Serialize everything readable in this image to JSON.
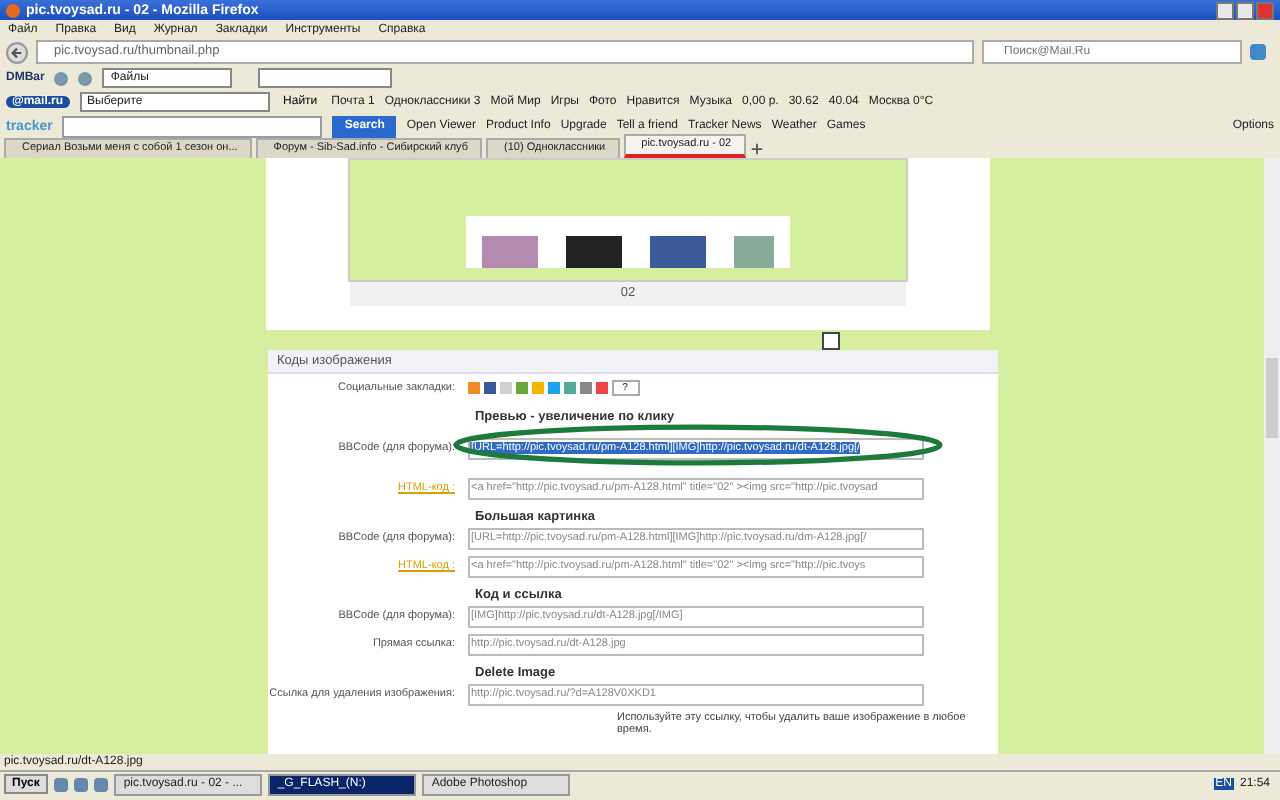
{
  "window": {
    "title": "pic.tvoysad.ru - 02 - Mozilla Firefox"
  },
  "menu": [
    "Файл",
    "Правка",
    "Вид",
    "Журнал",
    "Закладки",
    "Инструменты",
    "Справка"
  ],
  "navigation": {
    "url": "pic.tvoysad.ru/thumbnail.php",
    "search_placeholder": "Поиск@Mail.Ru"
  },
  "dmbar": {
    "logo": "DMBar",
    "dropdown": "Файлы"
  },
  "mail_toolbar": {
    "logo": "@mail.ru",
    "dropdown": "Выберите",
    "find": "Найти",
    "items": [
      "Почта 1",
      "Одноклассники 3",
      "Мой Мир",
      "Игры",
      "Фото",
      "Нравится",
      "Музыка",
      "0,00 р.",
      "30.62",
      "40.04",
      "Москва 0°C"
    ]
  },
  "tracker_toolbar": {
    "logo": "tracker",
    "search_button": "Search",
    "items": [
      "Open Viewer",
      "Product Info",
      "Upgrade",
      "Tell a friend",
      "Tracker News",
      "Weather",
      "Games"
    ],
    "options": "Options"
  },
  "tabs": [
    {
      "label": "Сериал Возьми меня с собой 1 сезон он...",
      "selected": false
    },
    {
      "label": "Форум - Sib-Sad.info - Сибирский клуб",
      "selected": false
    },
    {
      "label": "(10) Одноклассники",
      "selected": false
    },
    {
      "label": "pic.tvoysad.ru - 02",
      "selected": true
    }
  ],
  "preview": {
    "caption": "02"
  },
  "codes": {
    "title": "Коды изображения",
    "social_label": "Социальные закладки:",
    "help": "?",
    "sections": [
      {
        "heading": "Превью - увеличение по клику",
        "rows": [
          {
            "label": "BBCode (для форума):",
            "link": false,
            "value": "[URL=http://pic.tvoysad.ru/pm-A128.html][IMG]http://pic.tvoysad.ru/dt-A128.jpg[/",
            "selected": true
          },
          {
            "label": "HTML-код :",
            "link": true,
            "value": "<a href=\"http://pic.tvoysad.ru/pm-A128.html\" title=\"02\" ><img src=\"http://pic.tvoysad",
            "selected": false
          }
        ]
      },
      {
        "heading": "Большая картинка",
        "rows": [
          {
            "label": "BBCode (для форума):",
            "link": false,
            "value": "[URL=http://pic.tvoysad.ru/pm-A128.html][IMG]http://pic.tvoysad.ru/dm-A128.jpg[/",
            "selected": false
          },
          {
            "label": "HTML-код :",
            "link": true,
            "value": "<a href=\"http://pic.tvoysad.ru/pm-A128.html\" title=\"02\" ><img src=\"http://pic.tvoys",
            "selected": false
          }
        ]
      },
      {
        "heading": "Код и ссылка",
        "rows": [
          {
            "label": "BBCode (для форума):",
            "link": false,
            "value": "[IMG]http://pic.tvoysad.ru/dt-A128.jpg[/IMG]",
            "selected": false
          },
          {
            "label": "Прямая ссылка:",
            "link": false,
            "value": "http://pic.tvoysad.ru/dt-A128.jpg",
            "selected": false
          }
        ]
      },
      {
        "heading": "Delete Image",
        "rows": [
          {
            "label": "Ссылка для удаления изображения:",
            "link": false,
            "value": "http://pic.tvoysad.ru/?d=A128V0XKD1",
            "selected": false
          }
        ]
      }
    ],
    "note": "Используйте эту ссылку, чтобы удалить ваше изображение в любое время."
  },
  "status_bar": "pic.tvoysad.ru/dt-A128.jpg",
  "taskbar": {
    "start": "Пуск",
    "tasks": [
      {
        "label": "pic.tvoysad.ru - 02 - ...",
        "selected": false
      },
      {
        "label": "_G_FLASH_(N:)",
        "selected": true
      },
      {
        "label": "Adobe Photoshop",
        "selected": false
      }
    ],
    "language": "EN",
    "clock": "21:54"
  }
}
